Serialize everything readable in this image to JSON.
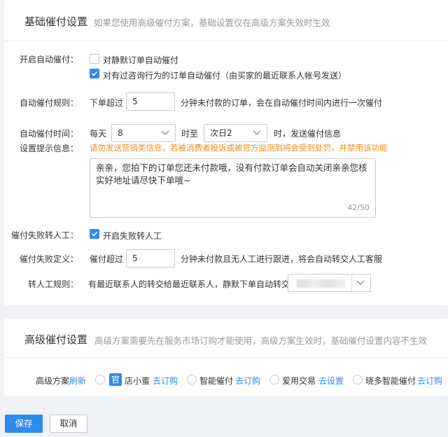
{
  "basic": {
    "title": "基础催付设置",
    "desc": "如果您使用高级催付方案，基础设置仅在高级方案失效时生效",
    "auto_label": "开启自动催付：",
    "auto_opt1": "对静默订单自动催付",
    "auto_opt1_checked": false,
    "auto_opt2": "对有过咨询行为的订单自动催付（由买家的最近联系人帐号发送）",
    "auto_opt2_checked": true,
    "rule_label": "自动催付规则：",
    "rule_prefix": "下单超过",
    "rule_value": "5",
    "rule_suffix": "分钟未付款的订单，会在自动催付时间内进行一次催付",
    "time_label": "自动催付时间：",
    "time_prefix": "每天",
    "time_start": "8",
    "time_mid": "时至",
    "time_end": "次日2",
    "time_suffix": "时，发送催付信息",
    "msg_label": "设置提示信息：",
    "msg_warning": "请勿发送营销类信息，若被消费者投诉或被官方监测到将会受到处罚，并禁用该功能",
    "msg_text": "亲亲，您拍下的订单您还未付款哦，没有付款订单会自动关闭亲亲您核实好地址请尽快下单哦~",
    "msg_count": "42/50",
    "fail_label": "催付失败转人工：",
    "fail_opt": "开启失败转人工",
    "fail_checked": true,
    "faildef_label": "催付失败定义：",
    "faildef_prefix": "催付超过",
    "faildef_value": "5",
    "faildef_suffix": "分钟未付款且无人工进行跟进，将会自动转交人工客服",
    "transfer_label": "转人工规则：",
    "transfer_text": "有最近联系人的转交给最近联系人，静默下单自动转交给"
  },
  "advanced": {
    "title": "高级催付设置",
    "desc": "高级方案需要先在服务市场订购才能使用，高级方案生效时，基础催付设置内容不生效",
    "plan_label": "高级方案",
    "refresh": "刷新",
    "options": [
      {
        "badge": "官",
        "name": "店小蜜",
        "action": "去订购"
      },
      {
        "badge": "",
        "name": "智能催付",
        "action": "去订购"
      },
      {
        "badge": "",
        "name": "爱用交易",
        "action": "去设置"
      },
      {
        "badge": "",
        "name": "晓多智能催付",
        "action": "去订购"
      }
    ]
  },
  "footer": {
    "save": "保存",
    "cancel": "取消"
  },
  "colors": {
    "primary": "#2d8cf0",
    "warning": "#f08c1c",
    "background": "#f0f2f5"
  }
}
